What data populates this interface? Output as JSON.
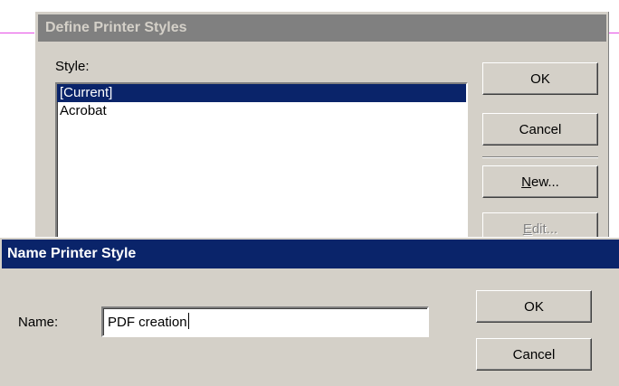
{
  "back_dialog": {
    "title": "Define Printer Styles",
    "style_label": "Style:",
    "styles": [
      {
        "label": "[Current]",
        "selected": true
      },
      {
        "label": "Acrobat",
        "selected": false
      }
    ],
    "buttons": {
      "ok": "OK",
      "cancel": "Cancel",
      "new_prefix": "N",
      "new_rest": "ew...",
      "edit_prefix": "E",
      "edit_rest": "dit..."
    }
  },
  "front_dialog": {
    "title": "Name Printer Style",
    "name_label": "Name:",
    "name_value": "PDF creation",
    "buttons": {
      "ok": "OK",
      "cancel": "Cancel"
    }
  },
  "colors": {
    "active_title": "#0a246a",
    "inactive_title": "#808080",
    "face": "#d4d0c8",
    "selection": "#0a246a"
  }
}
